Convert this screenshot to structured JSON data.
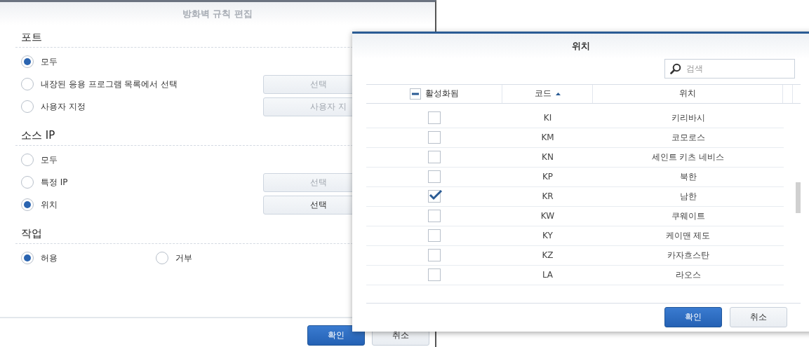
{
  "edit_dialog": {
    "title": "방화벽 규칙 편집",
    "sections": [
      {
        "heading": "포트",
        "kind": "stack",
        "options": [
          {
            "label": "모두",
            "selected": true
          },
          {
            "label": "내장된 응용 프로그램 목록에서 선택",
            "selected": false,
            "button": {
              "label": "선택",
              "disabled": true
            }
          },
          {
            "label": "사용자 지정",
            "selected": false,
            "button": {
              "label": "사용자 지",
              "disabled": true
            }
          }
        ]
      },
      {
        "heading": "소스 IP",
        "kind": "stack",
        "options": [
          {
            "label": "모두",
            "selected": false
          },
          {
            "label": "특정 IP",
            "selected": false,
            "button": {
              "label": "선택",
              "disabled": true
            }
          },
          {
            "label": "위치",
            "selected": true,
            "button": {
              "label": "선택",
              "disabled": false
            }
          }
        ]
      },
      {
        "heading": "작업",
        "kind": "inline",
        "options": [
          {
            "label": "허용",
            "selected": true
          },
          {
            "label": "거부",
            "selected": false
          }
        ]
      }
    ],
    "buttons": [
      {
        "label": "확인",
        "kind": "primary"
      },
      {
        "label": "취소",
        "kind": "secondary"
      }
    ]
  },
  "location_dialog": {
    "title": "위치",
    "search": {
      "placeholder": "검색"
    },
    "columns": [
      {
        "label": "활성화됨",
        "kind": "check"
      },
      {
        "label": "코드",
        "kind": "sort"
      },
      {
        "label": "위치",
        "kind": "text"
      }
    ],
    "header_indeterminate": true,
    "rows": [
      {
        "code": "KI",
        "name": "키리바시",
        "checked": false
      },
      {
        "code": "KM",
        "name": "코모로스",
        "checked": false
      },
      {
        "code": "KN",
        "name": "세인트 키츠 네비스",
        "checked": false
      },
      {
        "code": "KP",
        "name": "북한",
        "checked": false
      },
      {
        "code": "KR",
        "name": "남한",
        "checked": true
      },
      {
        "code": "KW",
        "name": "쿠웨이트",
        "checked": false
      },
      {
        "code": "KY",
        "name": "케이맨 제도",
        "checked": false
      },
      {
        "code": "KZ",
        "name": "카자흐스탄",
        "checked": false
      },
      {
        "code": "LA",
        "name": "라오스",
        "checked": false
      }
    ],
    "buttons": [
      {
        "label": "확인",
        "kind": "primary"
      },
      {
        "label": "취소",
        "kind": "secondary"
      }
    ]
  }
}
